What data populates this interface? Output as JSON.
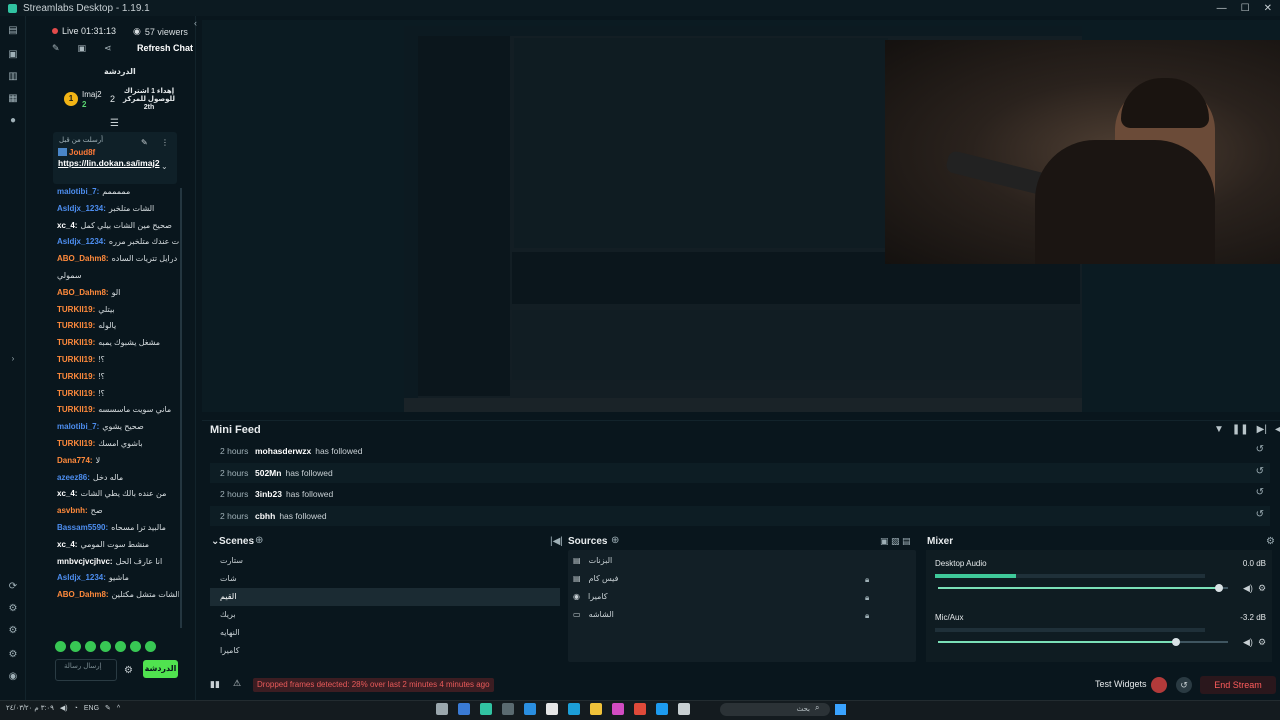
{
  "window": {
    "title": "Streamlabs Desktop - 1.19.1",
    "minimize": "—",
    "maximize": "☐",
    "close": "✕"
  },
  "chat": {
    "live_status": "Live 01:31:13",
    "viewers": "57 viewers",
    "refresh_label": "Refresh Chat",
    "header": "الدردشة",
    "goal": {
      "user": "Imaj2",
      "count": "2",
      "rank": "2",
      "text": "إهداء 1 اشتراك للوصول للمركز 2th"
    },
    "pinned": {
      "label": "أرسلت من قبل",
      "user": "Joud8f",
      "link": "https://lin.dokan.sa/imaj2"
    },
    "messages": [
      {
        "user": "malotibi_7:",
        "text": "مممممم",
        "color": "#4d8ef0"
      },
      {
        "user": "Asldjx_1234:",
        "text": "الشات متلخبر",
        "color": "#4d8ef0"
      },
      {
        "user": "xc_4:",
        "text": "صحيح مين الشات بيلي كمل",
        "color": "#ffffff"
      },
      {
        "user": "Asldjx_1234:",
        "text": "الشات عندك متلخبر مرره",
        "color": "#4d8ef0"
      },
      {
        "user": "ABO_Dahm8:",
        "text": "شوية درايل تتريات الساده",
        "color": "#ff8a3c"
      },
      {
        "user": "",
        "text": "سمولي",
        "color": "#ffffff"
      },
      {
        "user": "ABO_Dahm8:",
        "text": "الو",
        "color": "#ff8a3c"
      },
      {
        "user": "TURKII19:",
        "text": "بيتلي",
        "color": "#ff8a3c"
      },
      {
        "user": "TURKII19:",
        "text": "يالوله",
        "color": "#ff8a3c"
      },
      {
        "user": "TURKII19:",
        "text": "مشغل يشبوك يمبه",
        "color": "#ff8a3c"
      },
      {
        "user": "TURKII19:",
        "text": "!؟",
        "color": "#ff8a3c"
      },
      {
        "user": "TURKII19:",
        "text": "!؟",
        "color": "#ff8a3c"
      },
      {
        "user": "TURKII19:",
        "text": "!؟",
        "color": "#ff8a3c"
      },
      {
        "user": "TURKII19:",
        "text": "ماني سويت ماسسسه",
        "color": "#ff8a3c"
      },
      {
        "user": "malotibi_7:",
        "text": "صحيح يشوي",
        "color": "#4d8ef0"
      },
      {
        "user": "TURKII19:",
        "text": "باشوي امسك",
        "color": "#ff8a3c"
      },
      {
        "user": "Dana774:",
        "text": "لا",
        "color": "#ff8a3c"
      },
      {
        "user": "azeez86:",
        "text": "ماله دخل",
        "color": "#4d8ef0"
      },
      {
        "user": "xc_4:",
        "text": "من عنده بالك يطي الشات",
        "color": "#ffffff"
      },
      {
        "user": "asvbnh:",
        "text": "صح",
        "color": "#ff8a3c"
      },
      {
        "user": "Bassam5590:",
        "text": "مالبيد ترا مسحاه",
        "color": "#4d8ef0"
      },
      {
        "user": "xc_4:",
        "text": "منشط سوت المومي",
        "color": "#ffffff"
      },
      {
        "user": "mnbvcjvcjhvc:",
        "text": "انا عارف الحل",
        "color": "#ffffff"
      },
      {
        "user": "Asldjx_1234:",
        "text": "ماشيو",
        "color": "#4d8ef0"
      },
      {
        "user": "ABO_Dahm8:",
        "text": "ماجد الشات متشل مكتلين",
        "color": "#ff8a3c"
      }
    ],
    "input_placeholder": "إرسال رسالة",
    "send_label": "الدردشة"
  },
  "mini_feed": {
    "title": "Mini Feed",
    "rows": [
      {
        "time": "2 hours",
        "name": "mohasderwzx",
        "action": "has followed"
      },
      {
        "time": "2 hours",
        "name": "502Mn",
        "action": "has followed"
      },
      {
        "time": "2 hours",
        "name": "3inb23",
        "action": "has followed"
      },
      {
        "time": "2 hours",
        "name": "cbhh",
        "action": "has followed"
      }
    ]
  },
  "scenes": {
    "title": "Scenes",
    "items": [
      "ستارت",
      "شات",
      "القيم",
      "بريك",
      "النهايه",
      "كاميرا"
    ],
    "active_index": 2
  },
  "sources": {
    "title": "Sources",
    "items": [
      {
        "name": "البزنات",
        "icon": "folder-icon",
        "locked": false
      },
      {
        "name": "فيس كام",
        "icon": "folder-icon",
        "locked": true
      },
      {
        "name": "كاميرا",
        "icon": "camera-icon",
        "locked": true
      },
      {
        "name": "الشاشه",
        "icon": "monitor-icon",
        "locked": true
      }
    ]
  },
  "mixer": {
    "title": "Mixer",
    "channels": [
      {
        "name": "Desktop Audio",
        "db": "0.0 dB",
        "level": 0.3,
        "volume": 0.97
      },
      {
        "name": "Mic/Aux",
        "db": "-3.2 dB",
        "level": 0.0,
        "volume": 0.82
      }
    ]
  },
  "status": {
    "warning": "Dropped frames detected: 28% over last 2 minutes 4 minutes ago",
    "test_widgets": "Test Widgets",
    "end_stream": "End Stream"
  },
  "taskbar": {
    "lang": "ENG",
    "search": "بحث",
    "time": "٣:٠٩ م",
    "date": "٢٤/٠٣/٢٠"
  },
  "colors": {
    "accent": "#31c3a2",
    "chat_green": "#50e34f",
    "danger": "#ff5c5c"
  }
}
